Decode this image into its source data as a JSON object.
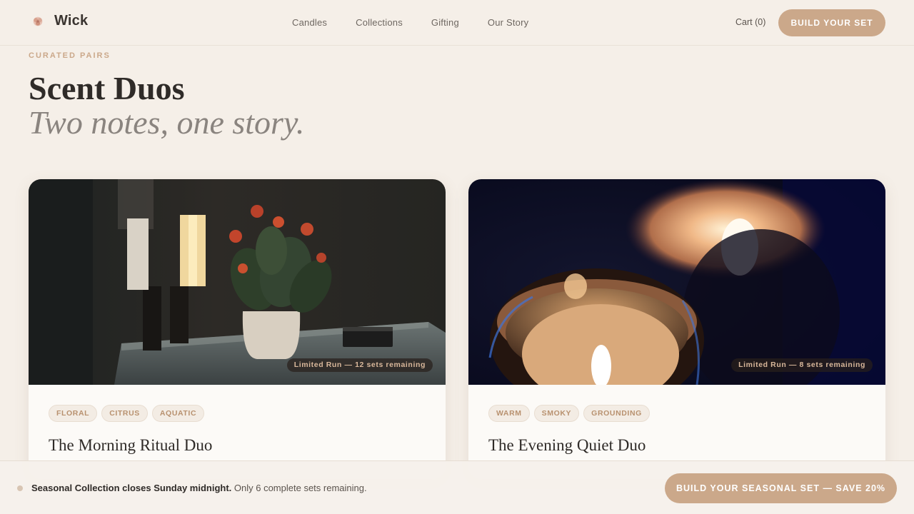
{
  "brand": {
    "name": "Wick",
    "icon": "rose-icon"
  },
  "nav": {
    "items": [
      "Candles",
      "Collections",
      "Gifting",
      "Our Story"
    ]
  },
  "header": {
    "cart_label": "Cart (0)",
    "cta_label": "BUILD YOUR SET"
  },
  "hero": {
    "eyebrow": "CURATED PAIRS",
    "title": "Scent Duos",
    "subtitle": "Two notes, one story."
  },
  "cards": [
    {
      "title": "The Morning Ritual Duo",
      "badge": "Limited Run — 12 sets remaining",
      "tags": [
        "FLORAL",
        "CITRUS",
        "AQUATIC"
      ]
    },
    {
      "title": "The Evening Quiet Duo",
      "badge": "Limited Run — 8 sets remaining",
      "tags": [
        "WARM",
        "SMOKY",
        "GROUNDING"
      ]
    }
  ],
  "bottom_bar": {
    "notice_bold": "Seasonal Collection closes Sunday midnight.",
    "notice_rest": " Only 6 complete sets remaining.",
    "cta_label": "BUILD YOUR SEASONAL SET — SAVE 20%"
  },
  "colors": {
    "accent": "#cba88a",
    "background": "#f5efe8",
    "text": "#2f2b28"
  }
}
